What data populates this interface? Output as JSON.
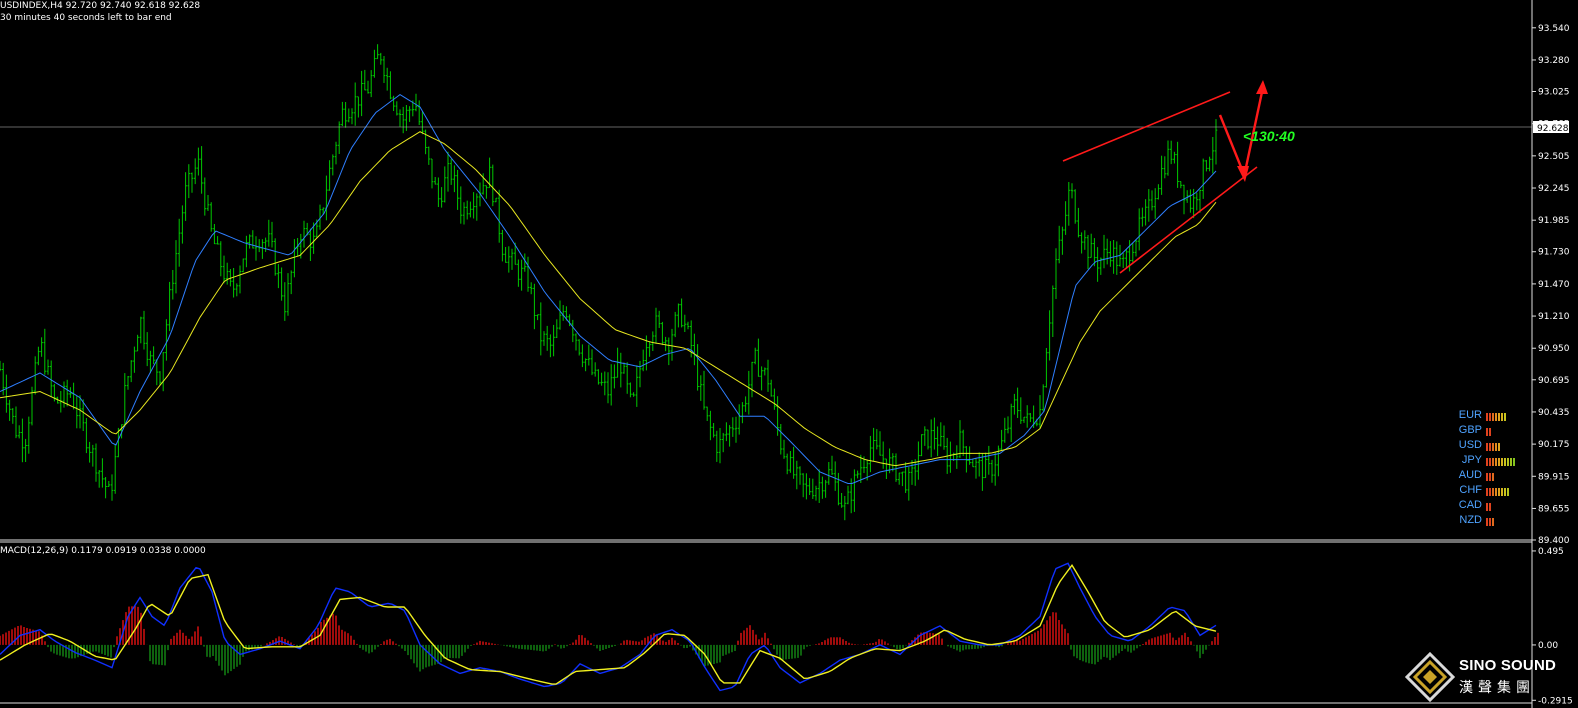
{
  "header": {
    "symbol_line": "USDINDEX,H4  92.720 92.740 92.618 92.628",
    "timer_line": "30 minutes 40 seconds left to bar end"
  },
  "macd_header": "MACD(12,26,9) 0.1179 0.0919 0.0338 0.0000",
  "annotation": {
    "text": "<130:40",
    "color": "#22ff22"
  },
  "price_axis": {
    "ticks": [
      "93.540",
      "93.280",
      "93.025",
      "92.765",
      "92.628",
      "92.505",
      "92.245",
      "91.985",
      "91.730",
      "91.470",
      "91.210",
      "90.950",
      "90.695",
      "90.435",
      "90.175",
      "89.915",
      "89.655",
      "89.400"
    ],
    "current": "92.628"
  },
  "macd_axis": {
    "ticks": [
      "0.495",
      "0.00",
      "-0.2915"
    ]
  },
  "currency_strength": [
    {
      "name": "EUR",
      "bars": [
        "#e0421e",
        "#e0421e",
        "#e06a1e",
        "#e08a1e",
        "#e0a41e",
        "#d6b41e",
        "#c8c41e"
      ]
    },
    {
      "name": "GBP",
      "bars": [
        "#e0421e",
        "#e0421e"
      ]
    },
    {
      "name": "USD",
      "bars": [
        "#e0421e",
        "#e0421e",
        "#e06a1e",
        "#e08a1e",
        "#e0a41e"
      ]
    },
    {
      "name": "JPY",
      "bars": [
        "#e0421e",
        "#e0421e",
        "#e06a1e",
        "#e08a1e",
        "#e0a41e",
        "#d6b41e",
        "#c8c41e",
        "#b4c41e",
        "#9cc41e",
        "#84c41e"
      ]
    },
    {
      "name": "AUD",
      "bars": [
        "#e0421e",
        "#e0421e",
        "#e06a1e"
      ]
    },
    {
      "name": "CHF",
      "bars": [
        "#e0421e",
        "#e0421e",
        "#e06a1e",
        "#e08a1e",
        "#e0a41e",
        "#d6b41e",
        "#c8c41e",
        "#b4c41e"
      ]
    },
    {
      "name": "CAD",
      "bars": [
        "#e0421e",
        "#e0421e"
      ]
    },
    {
      "name": "NZD",
      "bars": [
        "#e0421e",
        "#e0421e",
        "#e06a1e"
      ]
    }
  ],
  "logo": {
    "en": "SINO SOUND",
    "cn": "漢聲集團"
  },
  "chart_data": {
    "type": "line",
    "ylim": [
      89.4,
      93.7
    ],
    "bars": 380,
    "close": [
      [
        0,
        90.78
      ],
      [
        15,
        90.3
      ],
      [
        25,
        90.2
      ],
      [
        40,
        91.0
      ],
      [
        55,
        90.5
      ],
      [
        70,
        90.6
      ],
      [
        90,
        90.15
      ],
      [
        110,
        89.75
      ],
      [
        125,
        90.6
      ],
      [
        140,
        91.2
      ],
      [
        150,
        90.85
      ],
      [
        160,
        90.75
      ],
      [
        172,
        91.5
      ],
      [
        185,
        92.2
      ],
      [
        198,
        92.45
      ],
      [
        212,
        91.85
      ],
      [
        222,
        91.6
      ],
      [
        232,
        91.4
      ],
      [
        245,
        91.75
      ],
      [
        258,
        91.85
      ],
      [
        270,
        91.8
      ],
      [
        285,
        91.3
      ],
      [
        300,
        91.9
      ],
      [
        315,
        91.8
      ],
      [
        330,
        92.4
      ],
      [
        342,
        92.85
      ],
      [
        355,
        92.95
      ],
      [
        368,
        93.05
      ],
      [
        380,
        93.35
      ],
      [
        392,
        93.0
      ],
      [
        403,
        92.8
      ],
      [
        415,
        92.95
      ],
      [
        425,
        92.55
      ],
      [
        438,
        92.15
      ],
      [
        450,
        92.4
      ],
      [
        462,
        92.05
      ],
      [
        475,
        92.2
      ],
      [
        490,
        92.35
      ],
      [
        503,
        91.75
      ],
      [
        515,
        91.6
      ],
      [
        528,
        91.5
      ],
      [
        540,
        91.05
      ],
      [
        552,
        90.95
      ],
      [
        565,
        91.3
      ],
      [
        580,
        90.95
      ],
      [
        595,
        90.7
      ],
      [
        608,
        90.6
      ],
      [
        620,
        90.85
      ],
      [
        632,
        90.45
      ],
      [
        645,
        91.0
      ],
      [
        655,
        91.15
      ],
      [
        668,
        91.0
      ],
      [
        680,
        91.25
      ],
      [
        692,
        90.95
      ],
      [
        705,
        90.4
      ],
      [
        718,
        90.15
      ],
      [
        730,
        90.3
      ],
      [
        742,
        90.45
      ],
      [
        755,
        90.85
      ],
      [
        768,
        90.7
      ],
      [
        780,
        90.2
      ],
      [
        792,
        89.95
      ],
      [
        805,
        89.8
      ],
      [
        818,
        89.85
      ],
      [
        830,
        89.95
      ],
      [
        845,
        89.65
      ],
      [
        858,
        89.95
      ],
      [
        870,
        90.15
      ],
      [
        885,
        90.05
      ],
      [
        898,
        89.95
      ],
      [
        910,
        89.85
      ],
      [
        922,
        90.2
      ],
      [
        935,
        90.25
      ],
      [
        948,
        90.05
      ],
      [
        960,
        90.2
      ],
      [
        975,
        90.0
      ],
      [
        990,
        89.95
      ],
      [
        1003,
        90.2
      ],
      [
        1015,
        90.5
      ],
      [
        1028,
        90.35
      ],
      [
        1040,
        90.45
      ],
      [
        1048,
        91.1
      ],
      [
        1056,
        91.65
      ],
      [
        1063,
        91.9
      ],
      [
        1070,
        92.25
      ],
      [
        1078,
        91.95
      ],
      [
        1088,
        91.75
      ],
      [
        1098,
        91.65
      ],
      [
        1110,
        91.75
      ],
      [
        1122,
        91.6
      ],
      [
        1135,
        91.85
      ],
      [
        1148,
        92.05
      ],
      [
        1160,
        92.35
      ],
      [
        1170,
        92.55
      ],
      [
        1180,
        92.3
      ],
      [
        1192,
        92.1
      ],
      [
        1202,
        92.35
      ],
      [
        1210,
        92.55
      ],
      [
        1218,
        92.65
      ]
    ],
    "ema_fast": [
      [
        0,
        90.6
      ],
      [
        40,
        90.75
      ],
      [
        80,
        90.55
      ],
      [
        115,
        90.15
      ],
      [
        140,
        90.6
      ],
      [
        170,
        91.05
      ],
      [
        195,
        91.65
      ],
      [
        215,
        91.9
      ],
      [
        245,
        91.8
      ],
      [
        290,
        91.7
      ],
      [
        325,
        92.05
      ],
      [
        350,
        92.55
      ],
      [
        375,
        92.85
      ],
      [
        400,
        93.0
      ],
      [
        420,
        92.9
      ],
      [
        445,
        92.55
      ],
      [
        480,
        92.2
      ],
      [
        510,
        91.85
      ],
      [
        545,
        91.4
      ],
      [
        580,
        91.05
      ],
      [
        610,
        90.85
      ],
      [
        640,
        90.8
      ],
      [
        665,
        90.9
      ],
      [
        690,
        90.95
      ],
      [
        715,
        90.7
      ],
      [
        740,
        90.4
      ],
      [
        765,
        90.4
      ],
      [
        790,
        90.2
      ],
      [
        820,
        89.95
      ],
      [
        850,
        89.85
      ],
      [
        880,
        89.95
      ],
      [
        910,
        90.0
      ],
      [
        940,
        90.05
      ],
      [
        970,
        90.05
      ],
      [
        1000,
        90.1
      ],
      [
        1025,
        90.25
      ],
      [
        1045,
        90.45
      ],
      [
        1060,
        90.95
      ],
      [
        1075,
        91.45
      ],
      [
        1095,
        91.65
      ],
      [
        1120,
        91.7
      ],
      [
        1145,
        91.9
      ],
      [
        1170,
        92.1
      ],
      [
        1195,
        92.2
      ],
      [
        1218,
        92.4
      ]
    ],
    "ema_slow": [
      [
        0,
        90.55
      ],
      [
        40,
        90.6
      ],
      [
        80,
        90.45
      ],
      [
        115,
        90.25
      ],
      [
        140,
        90.45
      ],
      [
        170,
        90.75
      ],
      [
        200,
        91.2
      ],
      [
        225,
        91.5
      ],
      [
        260,
        91.6
      ],
      [
        300,
        91.7
      ],
      [
        330,
        91.95
      ],
      [
        360,
        92.3
      ],
      [
        390,
        92.55
      ],
      [
        420,
        92.7
      ],
      [
        445,
        92.6
      ],
      [
        475,
        92.4
      ],
      [
        510,
        92.1
      ],
      [
        545,
        91.7
      ],
      [
        580,
        91.35
      ],
      [
        615,
        91.1
      ],
      [
        650,
        91.0
      ],
      [
        685,
        90.95
      ],
      [
        715,
        90.8
      ],
      [
        745,
        90.65
      ],
      [
        775,
        90.5
      ],
      [
        805,
        90.3
      ],
      [
        835,
        90.15
      ],
      [
        865,
        90.05
      ],
      [
        895,
        90.0
      ],
      [
        930,
        90.05
      ],
      [
        960,
        90.1
      ],
      [
        990,
        90.1
      ],
      [
        1015,
        90.15
      ],
      [
        1040,
        90.3
      ],
      [
        1060,
        90.65
      ],
      [
        1080,
        91.0
      ],
      [
        1100,
        91.25
      ],
      [
        1125,
        91.45
      ],
      [
        1150,
        91.65
      ],
      [
        1175,
        91.85
      ],
      [
        1198,
        91.95
      ],
      [
        1218,
        92.15
      ]
    ],
    "macd": [
      [
        0,
        -0.05
      ],
      [
        20,
        0.05
      ],
      [
        40,
        0.08
      ],
      [
        55,
        0.02
      ],
      [
        75,
        -0.04
      ],
      [
        95,
        -0.08
      ],
      [
        112,
        -0.12
      ],
      [
        128,
        0.15
      ],
      [
        140,
        0.25
      ],
      [
        152,
        0.15
      ],
      [
        165,
        0.1
      ],
      [
        180,
        0.3
      ],
      [
        198,
        0.42
      ],
      [
        212,
        0.28
      ],
      [
        225,
        0.02
      ],
      [
        240,
        -0.05
      ],
      [
        260,
        -0.02
      ],
      [
        280,
        0.02
      ],
      [
        300,
        -0.02
      ],
      [
        318,
        0.1
      ],
      [
        335,
        0.3
      ],
      [
        350,
        0.28
      ],
      [
        370,
        0.2
      ],
      [
        390,
        0.22
      ],
      [
        405,
        0.18
      ],
      [
        420,
        0.0
      ],
      [
        440,
        -0.1
      ],
      [
        460,
        -0.15
      ],
      [
        480,
        -0.12
      ],
      [
        500,
        -0.14
      ],
      [
        520,
        -0.18
      ],
      [
        545,
        -0.22
      ],
      [
        562,
        -0.2
      ],
      [
        580,
        -0.1
      ],
      [
        600,
        -0.15
      ],
      [
        620,
        -0.12
      ],
      [
        640,
        -0.05
      ],
      [
        655,
        0.05
      ],
      [
        672,
        0.08
      ],
      [
        690,
        0.02
      ],
      [
        705,
        -0.12
      ],
      [
        720,
        -0.24
      ],
      [
        735,
        -0.22
      ],
      [
        750,
        -0.05
      ],
      [
        765,
        0.0
      ],
      [
        780,
        -0.12
      ],
      [
        800,
        -0.2
      ],
      [
        820,
        -0.15
      ],
      [
        840,
        -0.08
      ],
      [
        860,
        -0.05
      ],
      [
        880,
        0.0
      ],
      [
        900,
        -0.05
      ],
      [
        920,
        0.05
      ],
      [
        940,
        0.1
      ],
      [
        960,
        0.02
      ],
      [
        980,
        0.0
      ],
      [
        1000,
        0.0
      ],
      [
        1020,
        0.05
      ],
      [
        1040,
        0.15
      ],
      [
        1055,
        0.4
      ],
      [
        1068,
        0.43
      ],
      [
        1080,
        0.3
      ],
      [
        1095,
        0.15
      ],
      [
        1110,
        0.05
      ],
      [
        1130,
        0.02
      ],
      [
        1150,
        0.1
      ],
      [
        1170,
        0.2
      ],
      [
        1185,
        0.18
      ],
      [
        1200,
        0.05
      ],
      [
        1218,
        0.11
      ]
    ],
    "signal": [
      [
        0,
        -0.08
      ],
      [
        25,
        0.0
      ],
      [
        50,
        0.06
      ],
      [
        70,
        0.02
      ],
      [
        95,
        -0.06
      ],
      [
        115,
        -0.08
      ],
      [
        135,
        0.08
      ],
      [
        150,
        0.22
      ],
      [
        170,
        0.15
      ],
      [
        190,
        0.35
      ],
      [
        208,
        0.37
      ],
      [
        225,
        0.12
      ],
      [
        245,
        -0.02
      ],
      [
        270,
        -0.01
      ],
      [
        300,
        -0.01
      ],
      [
        320,
        0.05
      ],
      [
        340,
        0.24
      ],
      [
        360,
        0.25
      ],
      [
        385,
        0.2
      ],
      [
        405,
        0.2
      ],
      [
        425,
        0.05
      ],
      [
        445,
        -0.07
      ],
      [
        470,
        -0.13
      ],
      [
        500,
        -0.14
      ],
      [
        530,
        -0.18
      ],
      [
        555,
        -0.21
      ],
      [
        575,
        -0.14
      ],
      [
        600,
        -0.13
      ],
      [
        625,
        -0.12
      ],
      [
        645,
        -0.04
      ],
      [
        665,
        0.06
      ],
      [
        685,
        0.05
      ],
      [
        705,
        -0.05
      ],
      [
        722,
        -0.2
      ],
      [
        740,
        -0.2
      ],
      [
        760,
        -0.03
      ],
      [
        780,
        -0.07
      ],
      [
        805,
        -0.18
      ],
      [
        830,
        -0.14
      ],
      [
        850,
        -0.07
      ],
      [
        875,
        -0.02
      ],
      [
        900,
        -0.03
      ],
      [
        925,
        0.02
      ],
      [
        945,
        0.08
      ],
      [
        965,
        0.03
      ],
      [
        990,
        0.0
      ],
      [
        1015,
        0.02
      ],
      [
        1040,
        0.1
      ],
      [
        1058,
        0.32
      ],
      [
        1072,
        0.42
      ],
      [
        1088,
        0.28
      ],
      [
        1105,
        0.12
      ],
      [
        1125,
        0.04
      ],
      [
        1150,
        0.08
      ],
      [
        1175,
        0.18
      ],
      [
        1195,
        0.1
      ],
      [
        1218,
        0.07
      ]
    ],
    "macd_ylim": [
      -0.29,
      0.5
    ]
  }
}
